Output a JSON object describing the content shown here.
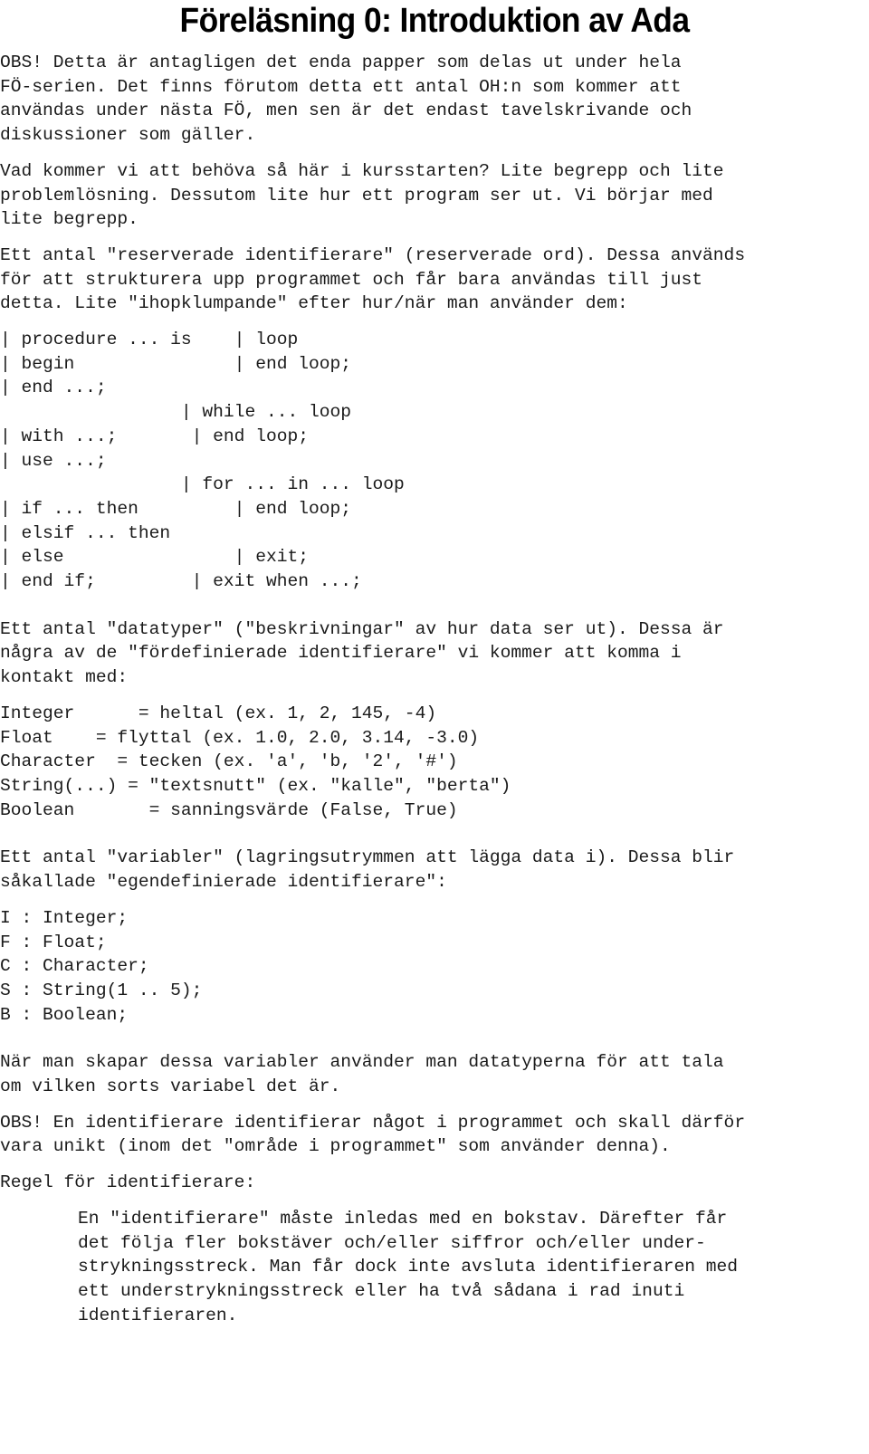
{
  "document": {
    "title": "Föreläsning 0: Introduktion av Ada",
    "language": "sv"
  },
  "paragraphs": {
    "intro_obs": "OBS! Detta är antagligen det enda papper som delas ut under hela\nFÖ-serien. Det finns förutom detta ett antal OH:n som kommer att\nanvändas under nästa FÖ, men sen är det endast tavelskrivande och\ndiskussioner som gäller.",
    "kursstart": "Vad kommer vi att behöva så här i kursstarten? Lite begrepp och lite\nproblemlösning. Dessutom lite hur ett program ser ut. Vi börjar med\nlite begrepp.",
    "reserverade": "Ett antal \"reserverade identifierare\" (reserverade ord). Dessa används\nför att strukturera upp programmet och får bara användas till just\ndetta. Lite \"ihopklumpande\" efter hur/när man använder dem:",
    "datatyper": "Ett antal \"datatyper\" (\"beskrivningar\" av hur data ser ut). Dessa är\nnågra av de \"fördefinierade identifierare\" vi kommer att komma i\nkontakt med:",
    "variabler": "Ett antal \"variabler\" (lagringsutrymmen att lägga data i). Dessa blir\nsåkallade \"egendefinierade identifierare\":",
    "skapar": "När man skapar dessa variabler använder man datatyperna för att tala\nom vilken sorts variabel det är.",
    "obs_unik": "OBS! En identifierare identifierar något i programmet och skall därför\nvara unikt (inom det \"område i programmet\" som använder denna).",
    "regel_heading": "Regel för identifierare:",
    "regel_body": "En \"identifierare\" måste inledas med en bokstav. Därefter får\ndet följa fler bokstäver och/eller siffror och/eller under-\nstrykningsstreck. Man får dock inte avsluta identifieraren med\nett understrykningsstreck eller ha två sådana i rad inuti\nidentifieraren."
  },
  "code_blocks": {
    "reserved_words": "| procedure ... is    | loop\n| begin               | end loop;\n| end ...;\n                 | while ... loop\n| with ...;       | end loop;\n| use ...;\n                 | for ... in ... loop\n| if ... then         | end loop;\n| elsif ... then\n| else                | exit;\n| end if;         | exit when ...;",
    "datatypes": "Integer      = heltal (ex. 1, 2, 145, -4)\nFloat    = flyttal (ex. 1.0, 2.0, 3.14, -3.0)\nCharacter  = tecken (ex. 'a', 'b, '2', '#')\nString(...) = \"textsnutt\" (ex. \"kalle\", \"berta\")\nBoolean       = sanningsvärde (False, True)",
    "variables": "I : Integer;\nF : Float;\nC : Character;\nS : String(1 .. 5);\nB : Boolean;"
  },
  "reserved_word_rows": [
    {
      "left": "| procedure ... is",
      "right": "| loop"
    },
    {
      "left": "| begin",
      "right": "| end loop;"
    },
    {
      "left": "| end ...;",
      "right": ""
    },
    {
      "left": "",
      "right": "| while ... loop"
    },
    {
      "left": "| with ...;",
      "right": "| end loop;"
    },
    {
      "left": "| use ...;",
      "right": ""
    },
    {
      "left": "",
      "right": "| for ... in ... loop"
    },
    {
      "left": "| if ... then",
      "right": "| end loop;"
    },
    {
      "left": "| elsif ... then",
      "right": ""
    },
    {
      "left": "| else",
      "right": "| exit;"
    },
    {
      "left": "| end if;",
      "right": "| exit when ...;"
    }
  ],
  "datatype_rows": [
    {
      "name": "Integer",
      "eq": "=",
      "desc": "heltal (ex. 1, 2, 145, -4)"
    },
    {
      "name": "Float",
      "eq": "=",
      "desc": "flyttal (ex. 1.0, 2.0, 3.14, -3.0)"
    },
    {
      "name": "Character",
      "eq": "=",
      "desc": "tecken (ex. 'a', 'b, '2', '#')"
    },
    {
      "name": "String(...)",
      "eq": "=",
      "desc": "\"textsnutt\" (ex. \"kalle\", \"berta\")"
    },
    {
      "name": "Boolean",
      "eq": "=",
      "desc": "sanningsvärde (False, True)"
    }
  ],
  "variable_rows": [
    {
      "name": "I",
      "colon": ":",
      "type": "Integer;"
    },
    {
      "name": "F",
      "colon": ":",
      "type": "Float;"
    },
    {
      "name": "C",
      "colon": ":",
      "type": "Character;"
    },
    {
      "name": "S",
      "colon": ":",
      "type": "String(1 .. 5);"
    },
    {
      "name": "B",
      "colon": ":",
      "type": "Boolean;"
    }
  ],
  "colors": {
    "page_background": "#ffffff",
    "text": "#1a1a1a",
    "title": "#000000"
  }
}
